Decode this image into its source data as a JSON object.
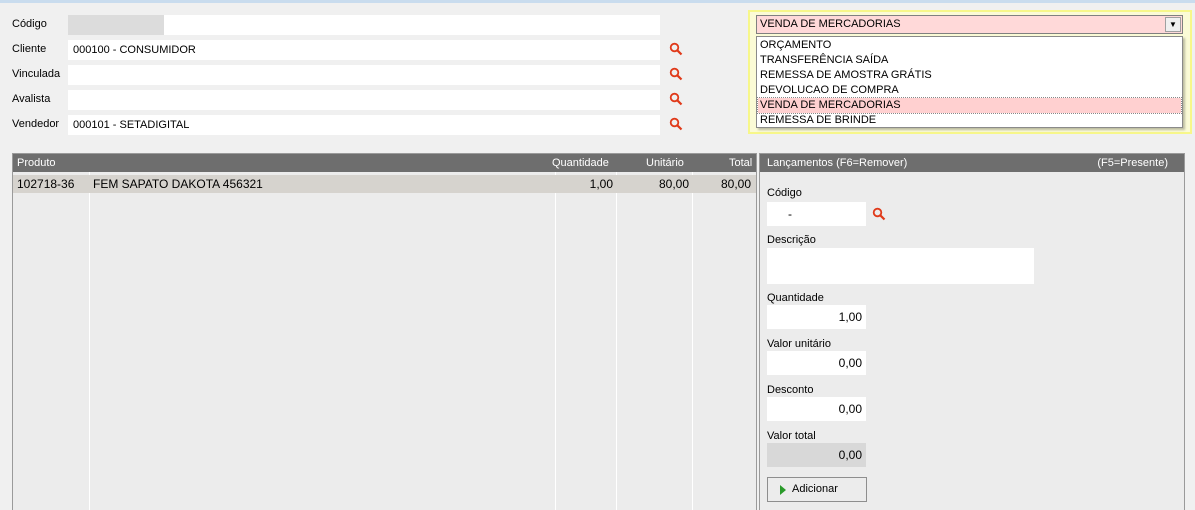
{
  "form": {
    "codigo_label": "Código",
    "cliente_label": "Cliente",
    "cliente_value": "000100 - CONSUMIDOR",
    "vinculada_label": "Vinculada",
    "vinculada_value": "",
    "avalista_label": "Avalista",
    "avalista_value": "",
    "vendedor_label": "Vendedor",
    "vendedor_value": "000101 - SETADIGITAL"
  },
  "operation": {
    "selected": "VENDA DE MERCADORIAS",
    "options": [
      "ORÇAMENTO",
      "TRANSFERÊNCIA SAÍDA",
      "REMESSA DE AMOSTRA GRÁTIS",
      "DEVOLUCAO DE COMPRA",
      "VENDA DE MERCADORIAS",
      "REMESSA DE BRINDE"
    ]
  },
  "grid": {
    "columns": {
      "produto": "Produto",
      "quantidade": "Quantidade",
      "unitario": "Unitário",
      "total": "Total"
    },
    "rows": [
      {
        "codigo": "102718-36",
        "descricao": "FEM SAPATO DAKOTA 456321",
        "quantidade": "1,00",
        "unitario": "80,00",
        "total": "80,00"
      }
    ]
  },
  "panel": {
    "title": "Lançamentos (F6=Remover)",
    "hint": "(F5=Presente)",
    "codigo_label": "Código",
    "codigo_value": "-",
    "descricao_label": "Descrição",
    "descricao_value": "",
    "quantidade_label": "Quantidade",
    "quantidade_value": "1,00",
    "valor_unitario_label": "Valor unitário",
    "valor_unitario_value": "0,00",
    "desconto_label": "Desconto",
    "desconto_value": "0,00",
    "valor_total_label": "Valor total",
    "valor_total_value": "0,00",
    "add_button": "Adicionar"
  },
  "colors": {
    "header_bg": "#6e6e6e",
    "selection_pink": "#ffd0d0",
    "search_icon": "#e03a1a",
    "add_icon": "#2a9a2a"
  }
}
